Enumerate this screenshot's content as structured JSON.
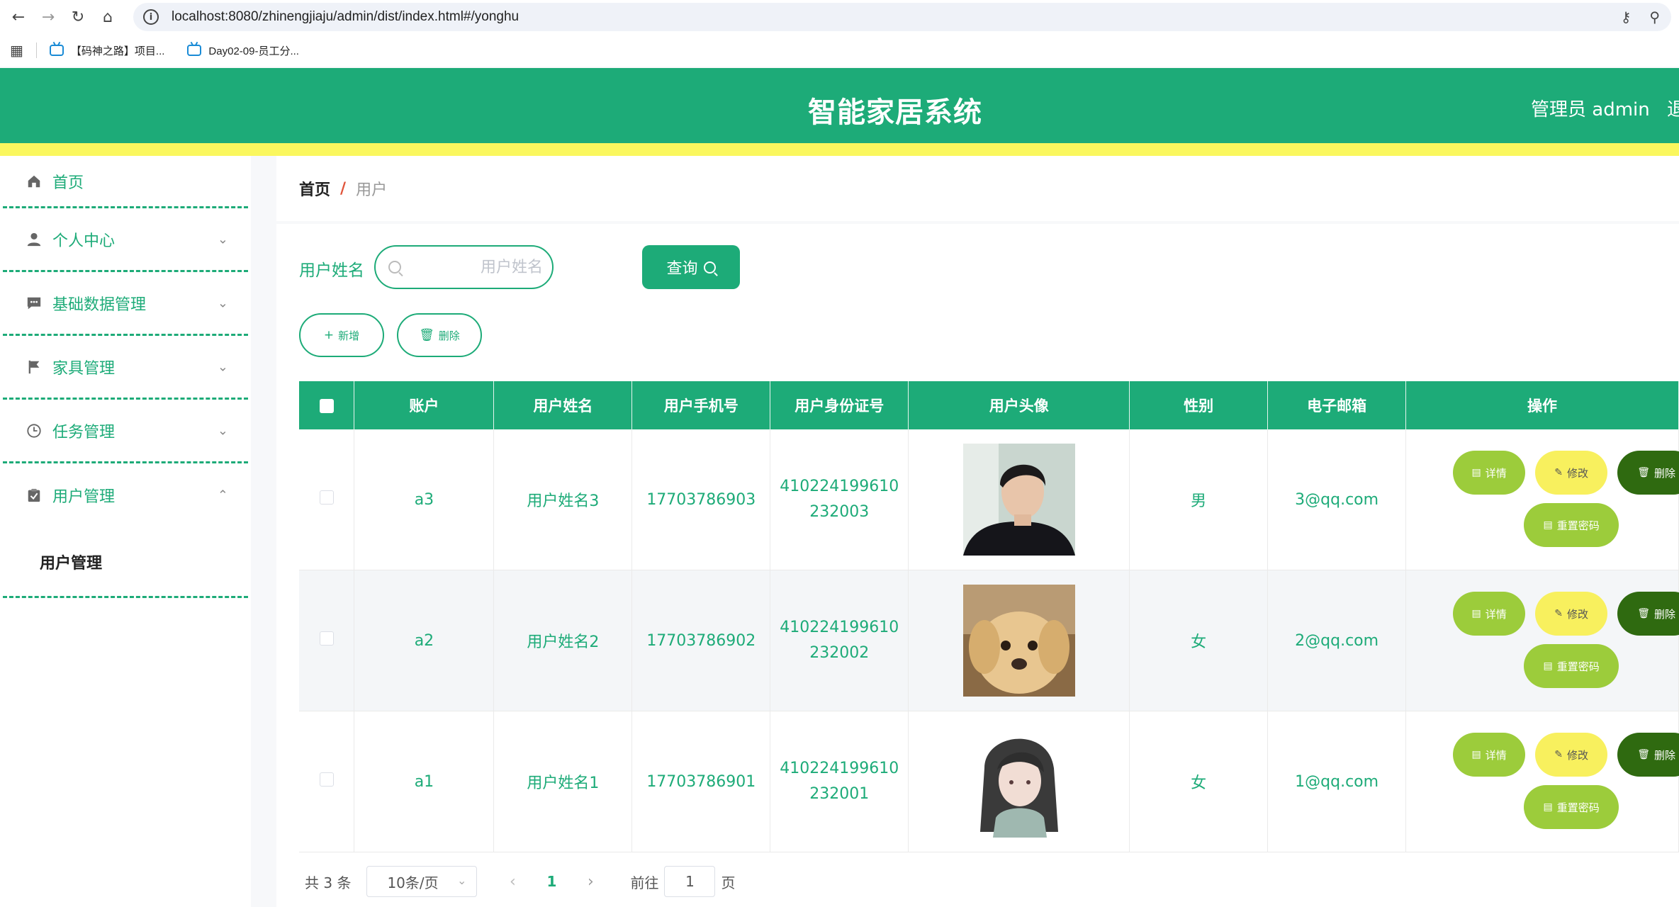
{
  "browser": {
    "url": "localhost:8080/zhinengjiaju/admin/dist/index.html#/yonghu",
    "bookmarks": [
      "【码神之路】项目...",
      "Day02-09-员工分..."
    ]
  },
  "header": {
    "title": "智能家居系统",
    "admin": "管理员 admin",
    "logout": "退"
  },
  "sidebar": {
    "items": [
      {
        "label": "首页"
      },
      {
        "label": "个人中心"
      },
      {
        "label": "基础数据管理"
      },
      {
        "label": "家具管理"
      },
      {
        "label": "任务管理"
      },
      {
        "label": "用户管理"
      }
    ],
    "submenu": "用户管理"
  },
  "breadcrumb": {
    "home": "首页",
    "separator": "/",
    "current": "用户"
  },
  "search": {
    "label": "用户姓名",
    "placeholder": "用户姓名",
    "button": "查询"
  },
  "actions": {
    "add": "新增",
    "delete": "删除"
  },
  "table": {
    "headers": [
      "账户",
      "用户姓名",
      "用户手机号",
      "用户身份证号",
      "用户头像",
      "性别",
      "电子邮箱",
      "操作"
    ],
    "rows": [
      {
        "account": "a3",
        "name": "用户姓名3",
        "phone": "17703786903",
        "id_line1": "410224199610",
        "id_line2": "232003",
        "gender": "男",
        "email": "3@qq.com"
      },
      {
        "account": "a2",
        "name": "用户姓名2",
        "phone": "17703786902",
        "id_line1": "410224199610",
        "id_line2": "232002",
        "gender": "女",
        "email": "2@qq.com"
      },
      {
        "account": "a1",
        "name": "用户姓名1",
        "phone": "17703786901",
        "id_line1": "410224199610",
        "id_line2": "232001",
        "gender": "女",
        "email": "1@qq.com"
      }
    ],
    "ops": {
      "detail": "详情",
      "edit": "修改",
      "delete": "删除",
      "reset": "重置密码"
    }
  },
  "pagination": {
    "total": "共 3 条",
    "page_size": "10条/页",
    "current": "1",
    "goto": "前往",
    "goto_value": "1",
    "page_suffix": "页"
  },
  "colors": {
    "primary": "#1dab78",
    "strip": "#faf75e",
    "detail": "#9ccc3b",
    "edit": "#f8f05e",
    "delete": "#2f6a10"
  }
}
